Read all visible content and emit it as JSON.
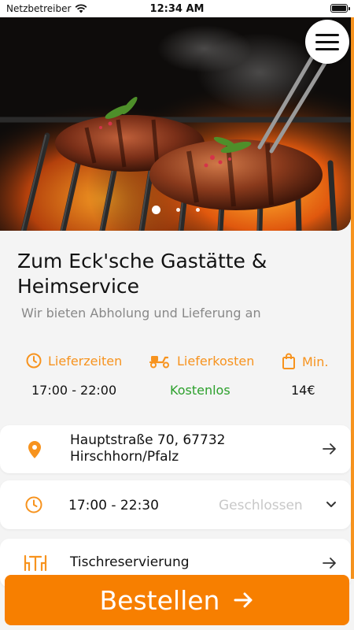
{
  "status_bar": {
    "carrier": "Netzbetreiber",
    "time": "12:34 AM"
  },
  "hero": {
    "image_icon": "grilled-steak-photo",
    "slide_count": 3,
    "active_slide": 1
  },
  "restaurant": {
    "name": "Zum Eck'sche Gastätte & Heimservice",
    "tagline": "Wir bieten Abholung und Lieferung an"
  },
  "info": {
    "delivery_times": {
      "label": "Lieferzeiten",
      "value": "17:00 - 22:00",
      "icon": "clock-icon"
    },
    "delivery_cost": {
      "label": "Lieferkosten",
      "value": "Kostenlos",
      "icon": "scooter-icon"
    },
    "minimum": {
      "label": "Min.",
      "value": "14€",
      "icon": "shopping-bag-icon"
    }
  },
  "address": {
    "line1": "Hauptstraße 70, 67732",
    "line2": "Hirschhorn/Pfalz"
  },
  "hours": {
    "time": "17:00 - 22:30",
    "status": "Geschlossen"
  },
  "reservation": {
    "label": "Tischreservierung"
  },
  "order_button": {
    "label": "Bestellen"
  },
  "colors": {
    "accent": "#f7931e",
    "button": "#f77f00",
    "free": "#2ca02c",
    "closed": "#c8c8c8"
  }
}
